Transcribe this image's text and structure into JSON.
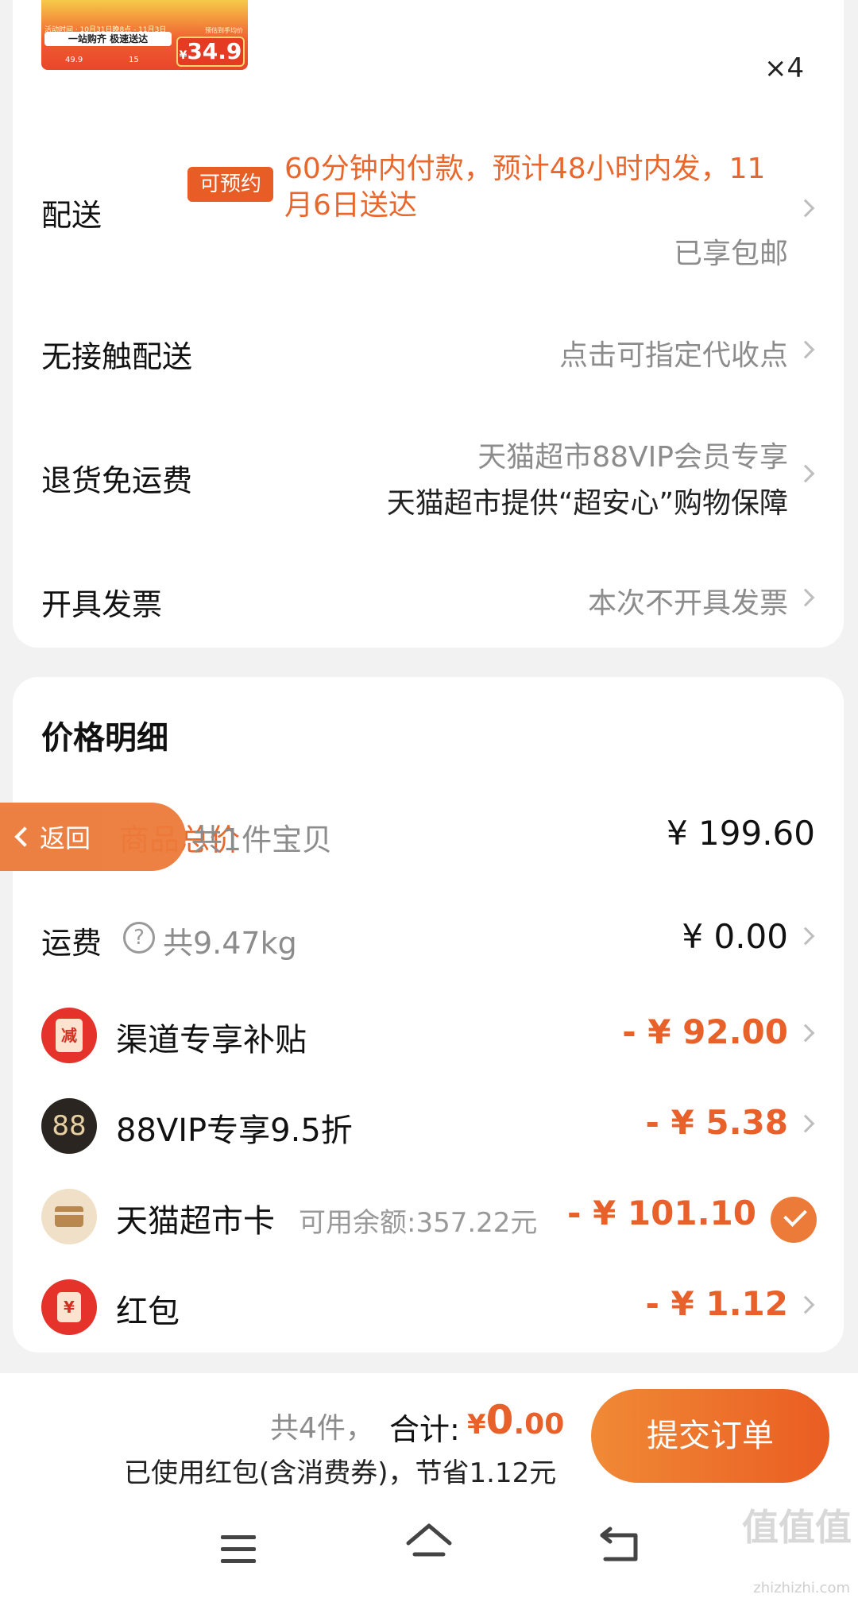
{
  "product": {
    "promo_line": "活动时间 · 10月31日晚8点 - 11月3日",
    "slogan": "一站购齐 极速送达",
    "price_a": "49.9",
    "price_b": "15",
    "low_tag": "预估到手均价",
    "price_symbol": "¥",
    "price": "34.9",
    "quantity": "×4"
  },
  "delivery": {
    "label": "配送",
    "tag": "可预约",
    "message": "60分钟内付款，预计48小时内发，11月6日送达",
    "shipping_note": "已享包邮"
  },
  "contactless": {
    "label": "无接触配送",
    "value": "点击可指定代收点"
  },
  "return_shipping": {
    "label": "退货免运费",
    "value_line1": "天猫超市88VIP会员专享",
    "value_line2": "天猫超市提供“超安心”购物保障"
  },
  "invoice": {
    "label": "开具发票",
    "value": "本次不开具发票"
  },
  "price_detail": {
    "title": "价格明细",
    "back_label": "返回",
    "goods_label": "商品总价",
    "goods_count": "共1件宝贝",
    "goods_total": "¥ 199.60",
    "shipping_label": "运费",
    "shipping_help": "?",
    "shipping_weight": "共9.47kg",
    "shipping_fee": "¥ 0.00",
    "discounts": [
      {
        "icon": "subsidy-icon",
        "icon_text": "减",
        "label": "渠道专享补贴",
        "amount": "- ¥ 92.00"
      },
      {
        "icon": "88vip-icon",
        "icon_text": "88",
        "label": "88VIP专享9.5折",
        "amount": "- ¥ 5.38"
      },
      {
        "icon": "tmall-card-icon",
        "label": "天猫超市卡",
        "sub": "可用余额:357.22元",
        "amount": "- ¥ 101.10"
      },
      {
        "icon": "red-packet-icon",
        "icon_text": "¥",
        "label": "红包",
        "amount": "- ¥ 1.12"
      }
    ]
  },
  "bottom_bar": {
    "count": "共4件，",
    "total_label": "合计:",
    "total_symbol": "¥",
    "total_int": "0",
    "total_dec": ".00",
    "savings": "已使用红包(含消费券)，节省1.12元",
    "submit": "提交订单"
  },
  "watermark": {
    "text": "值值值",
    "sub": "zhizhizhi.com"
  },
  "colors": {
    "accent": "#e8602a",
    "button": "#ea5d22",
    "muted": "#8c8c8c"
  }
}
